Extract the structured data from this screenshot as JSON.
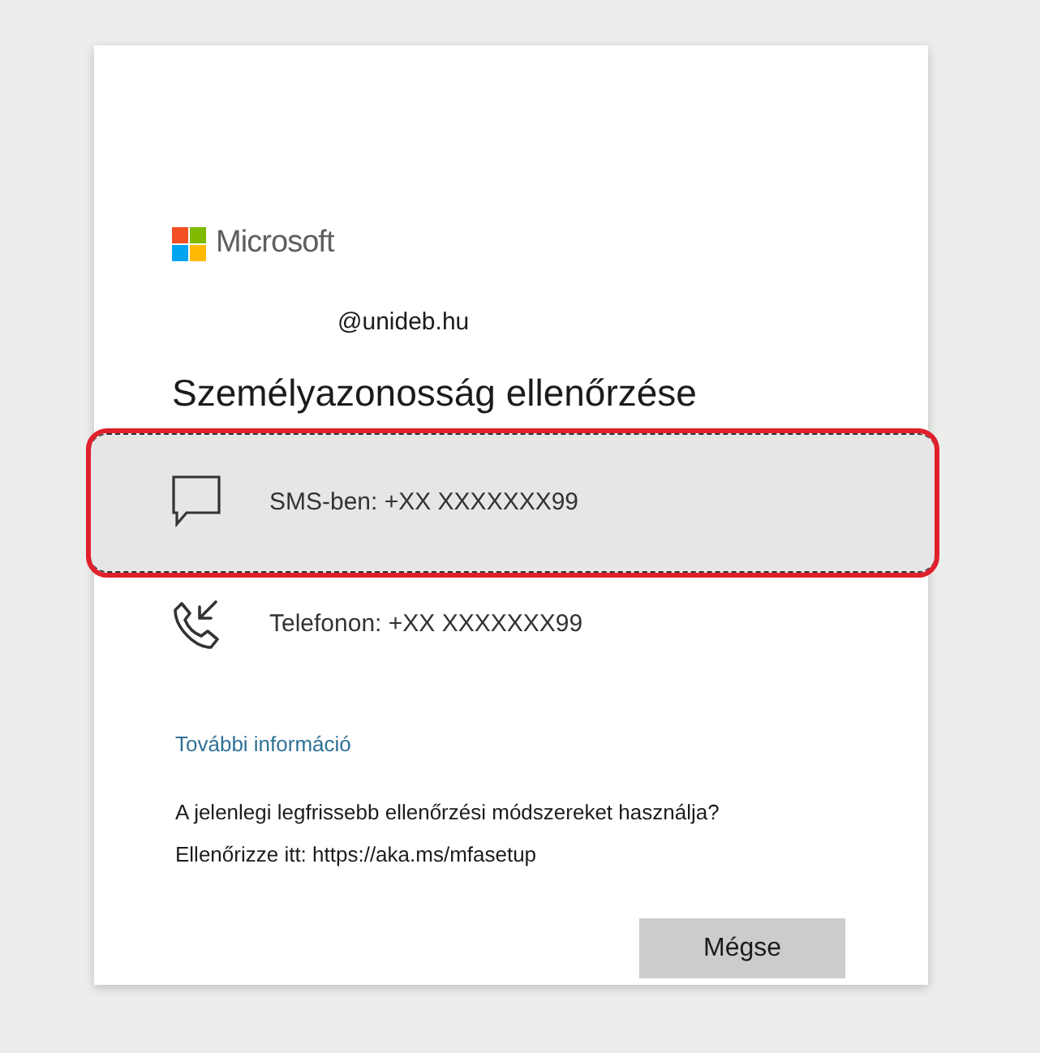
{
  "brand": {
    "name": "Microsoft"
  },
  "account": "@unideb.hu",
  "title": "Személyazonosság ellenőrzése",
  "options": [
    {
      "kind": "sms",
      "label": "SMS-ben: +XX XXXXXXX99",
      "selected": true,
      "highlighted": true
    },
    {
      "kind": "call",
      "label": "Telefonon: +XX XXXXXXX99",
      "selected": false,
      "highlighted": false
    }
  ],
  "more_info_link": "További információ",
  "notice": [
    "A jelenlegi legfrissebb ellenőrzési módszereket használja?",
    "Ellenőrizze itt: https://aka.ms/mfasetup"
  ],
  "cancel_button": "Mégse"
}
